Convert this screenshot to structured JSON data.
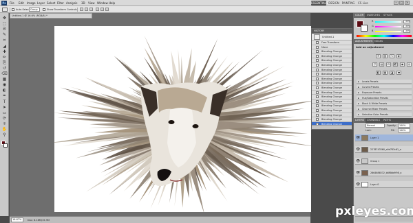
{
  "app": {
    "logo": "Ps",
    "menus": [
      "File",
      "Edit",
      "Image",
      "Layer",
      "Select",
      "Filter",
      "Analysis",
      "3D",
      "View",
      "Window",
      "Help"
    ],
    "workspaces": [
      "ESSENTIALS",
      "DESIGN",
      "PAINTING"
    ],
    "cs_live": "CS Live"
  },
  "options_bar": {
    "auto_select_label": "Auto-Select:",
    "auto_select_value": "Group",
    "show_transform_label": "Show Transform Controls"
  },
  "document": {
    "tab_title": "Untitled-1 @ 16.6% (RGB/8) *",
    "zoom": "16.67%",
    "doc_info": "Doc: 6.18M/15.3M"
  },
  "history_panel": {
    "tab": "HISTORY",
    "snapshot": "Untitled-1",
    "items": [
      "Free Transform",
      "Move",
      "Blending Change",
      "Blending Change",
      "Blending Change",
      "Blending Change",
      "Blending Change",
      "Blending Change",
      "Blending Change",
      "Blending Change",
      "Blending Change",
      "Blending Change",
      "Blending Change",
      "Blending Change",
      "Blending Change",
      "Blending Change",
      "Blending Change",
      "Blending Change",
      "Blending Change"
    ],
    "selected_index": 18
  },
  "color_panel": {
    "tabs": [
      "COLOR",
      "SWATCHES",
      "STYLES"
    ],
    "channels": [
      {
        "ch": "R",
        "value": "255"
      },
      {
        "ch": "G",
        "value": "255"
      },
      {
        "ch": "B",
        "value": "255"
      }
    ]
  },
  "adjustments_panel": {
    "tabs": [
      "ADJUSTMENTS",
      "MASKS"
    ],
    "title": "Add an adjustment",
    "presets": [
      "Levels Presets",
      "Curves Presets",
      "Exposure Presets",
      "Hue/Saturation Presets",
      "Black & White Presets",
      "Channel Mixer Presets",
      "Selective Color Presets"
    ]
  },
  "layers_panel": {
    "tabs": [
      "LAYERS",
      "CHANNELS",
      "PATHS"
    ],
    "blend_mode": "Normal",
    "opacity_label": "Opacity:",
    "opacity": "100%",
    "lock_label": "Lock:",
    "fill_label": "Fill:",
    "fill": "100%",
    "layers": [
      {
        "name": "Layer 1",
        "thumb": "#8c7a60",
        "visible": true
      },
      {
        "name": "2278743360_a9d783c61_o",
        "thumb": "#6d5b49",
        "visible": true
      },
      {
        "name": "Group 1",
        "thumb": "#c9c9c9",
        "visible": true
      },
      {
        "name": "2664686532_b6f8bb9f98_o",
        "thumb": "#7a6250",
        "visible": true
      },
      {
        "name": "Layer 0",
        "thumb": "#ffffff",
        "visible": true
      }
    ],
    "selected_index": 0
  },
  "toolbox": {
    "tools": [
      "move-tool",
      "marquee-tool",
      "lasso-tool",
      "quick-select-tool",
      "crop-tool",
      "eyedropper-tool",
      "healing-tool",
      "brush-tool",
      "clone-stamp-tool",
      "history-brush-tool",
      "eraser-tool",
      "gradient-tool",
      "blur-tool",
      "dodge-tool",
      "pen-tool",
      "type-tool",
      "path-select-tool",
      "shape-tool",
      "3d-rotate-tool",
      "3d-camera-tool",
      "hand-tool",
      "zoom-tool"
    ],
    "foreground_color": "#5a0a12",
    "background_color": "#ffffff"
  },
  "watermark": "pxleyes.com"
}
